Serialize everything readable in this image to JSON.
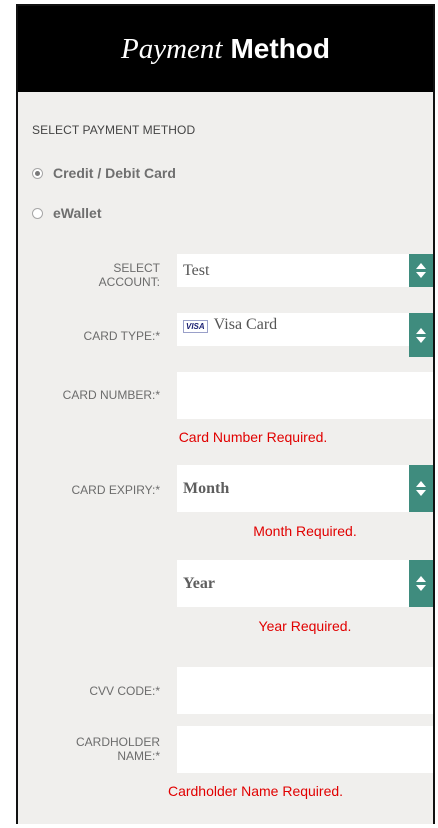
{
  "header": {
    "title_italic": "Payment",
    "title_bold": "Method"
  },
  "payment_method": {
    "section_title": "SELECT PAYMENT METHOD",
    "options": [
      {
        "label": "Credit / Debit Card",
        "selected": true
      },
      {
        "label": "eWallet",
        "selected": false
      }
    ]
  },
  "form": {
    "account": {
      "label_line1": "SELECT",
      "label_line2": "ACCOUNT:",
      "value": "Test"
    },
    "card_type": {
      "label": "CARD TYPE:*",
      "badge": "VISA",
      "value": "Visa Card"
    },
    "card_number": {
      "label": "CARD NUMBER:*",
      "value": "",
      "error": "Card Number Required."
    },
    "card_expiry": {
      "label": "CARD EXPIRY:*",
      "month_value": "Month",
      "month_error": "Month Required.",
      "year_value": "Year",
      "year_error": "Year Required."
    },
    "cvv": {
      "label": "CVV CODE:*",
      "value": ""
    },
    "cardholder": {
      "label_line1": "CARDHOLDER",
      "label_line2": "NAME:*",
      "value": "",
      "error": "Cardholder Name Required."
    }
  },
  "colors": {
    "header_bg": "#000000",
    "panel_bg": "#f0efed",
    "select_accent": "#3f8c7e",
    "error": "#e10000"
  },
  "icons": {
    "select_arrow": "sort-updown-icon",
    "radio": "radio-icon",
    "card_brand": "visa-icon"
  }
}
